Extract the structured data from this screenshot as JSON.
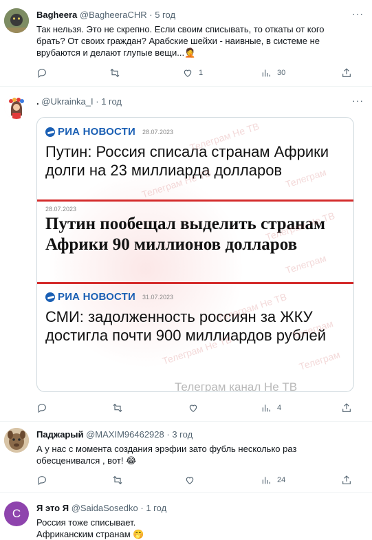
{
  "tweets": [
    {
      "name": "Bagheera",
      "handle": "@BagheeraCHR",
      "time": "5 год",
      "text": "Так нельзя. Это не скрепно. Если своим списывать, то откаты от кого брать? От своих граждан? Арабские шейхи - наивные, в системе не врубаются и делают глупые вещи...🤦",
      "likes": "1",
      "views": "30"
    },
    {
      "name": ".",
      "handle": "@Ukrainka_I",
      "time": "1 год",
      "views": "4"
    },
    {
      "name": "Паджарый",
      "handle": "@MAXIM96462928",
      "time": "3 год",
      "text": "А у нас с момента создания эрэфии зато фубль несколько раз обесценивался , вот! 😂",
      "views": "24"
    },
    {
      "name": "Я это Я",
      "handle": "@SaidaSosedko",
      "time": "1 год",
      "avatar_letter": "C",
      "text_line1": "Россия тоже списывает.",
      "text_line2": "Африканским странам 🤭"
    }
  ],
  "dot": "·",
  "more": "···",
  "media": {
    "ria_brand": "РИА НОВОСТИ",
    "date1": "28.07.2023",
    "headline1": "Путин: Россия списала странам Африки долги на 23 миллиарда долларов",
    "date2": "28.07.2023",
    "headline2": "Путин пообещал выделить странам Африки 90 миллионов долларов",
    "date3": "31.07.2023",
    "headline3": "СМИ: задолженность россиян за ЖКУ достигла почти 900 миллиардов рублей",
    "watermark": "Телеграм Не ТВ",
    "watermark2": "Телеграм",
    "footer": "Телеграм канал Не ТВ"
  },
  "colors": {
    "text": "#0f1419",
    "secondary": "#536471",
    "ria_blue": "#1a5fb4",
    "red_rule": "#d42b2b",
    "avatar_purple": "#8e44ad"
  }
}
